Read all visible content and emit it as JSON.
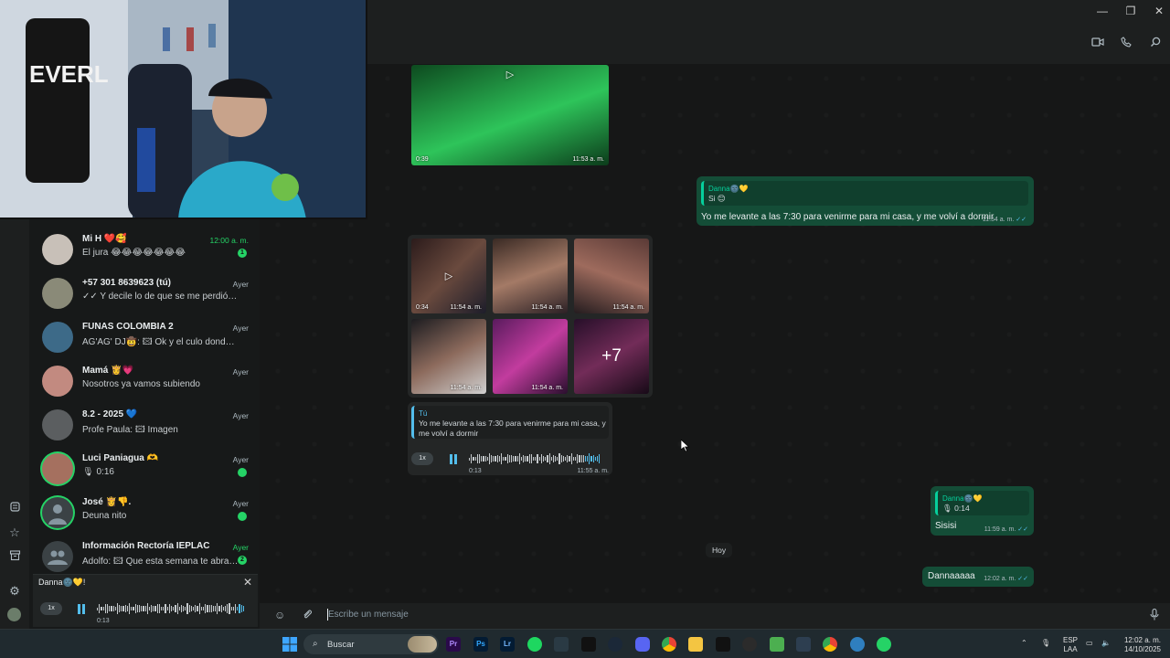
{
  "window": {
    "minimize": "—",
    "restore": "❐",
    "close": "✕"
  },
  "header_icons": {
    "video": "video-call-icon",
    "call": "phone-icon",
    "search": "search-icon"
  },
  "chats": [
    {
      "name": "Mi H ❤️🥰",
      "preview": "El jura 😂😂😂😂😂😂😂",
      "time": "12:00 a. m.",
      "time_green": true,
      "unread": "1"
    },
    {
      "name": "+57 301 8639623 (tú)",
      "preview": "✓✓ Y decile lo de que se me perdió el c...",
      "time": "Ayer"
    },
    {
      "name": "FUNAS COLOMBIA 2",
      "preview": "AG'AG' DJ🤠: 🖾 Ok y el culo donde lo...",
      "time": "Ayer"
    },
    {
      "name": "Mamá 👸💗",
      "preview": "Nosotros ya vamos subiendo",
      "time": "Ayer"
    },
    {
      "name": "8.2 - 2025 💙",
      "preview": "Profe Paula: 🖾 Imagen",
      "time": "Ayer"
    },
    {
      "name": "Luci Paniagua 🫶",
      "preview": "🎙 0:16",
      "time": "Ayer",
      "dot": true
    },
    {
      "name": "José 👸👎.",
      "preview": "Deuna nito",
      "time": "Ayer",
      "dot": true
    },
    {
      "name": "Información Rectoría IEPLAC",
      "preview": "Adolfo: 🖾 Que esta semana te abrace...",
      "time": "Ayer",
      "time_green": true,
      "unread": "2"
    }
  ],
  "mini_player": {
    "name": "Danna🌚💛!",
    "speed": "1x",
    "time": "0:13",
    "close": "✕"
  },
  "messages": {
    "top_video": {
      "duration": "0:39",
      "time": "11:53 a. m."
    },
    "reply1": {
      "quote_name": "Danna🌚💛",
      "quote_text": "Si 😊",
      "text": "Yo me levante a las 7:30 para venirme para mi casa, y me volví a dormir",
      "time": "11:54 a. m."
    },
    "album": {
      "video_duration": "0:34",
      "tile_time": "11:54 a. m.",
      "more": "+7"
    },
    "voice": {
      "quote_name": "Tú",
      "quote_text": "Yo me levante a las 7:30 para venirme para mi casa, y me volví a dormir",
      "speed": "1x",
      "duration": "0:13",
      "time": "11:55 a. m."
    },
    "reply2": {
      "quote_name": "Danna🌚💛",
      "quote_text": "🎙 0:14",
      "text": "Sisisi",
      "time": "11:59 a. m."
    },
    "day_divider": "Hoy",
    "last": {
      "text": "Dannaaaaa",
      "time": "12:02 a. m."
    }
  },
  "composer": {
    "placeholder": "Escribe un mensaje"
  },
  "taskbar": {
    "search": "Buscar",
    "apps": [
      "Pr",
      "Ps",
      "Lr"
    ],
    "lang": "ESP",
    "lang2": "LAA",
    "clock_time": "12:02 a. m.",
    "clock_date": "14/10/2025"
  },
  "colors": {
    "outgoing": "#144d37",
    "accent": "#25d366",
    "played": "#53bdeb"
  }
}
